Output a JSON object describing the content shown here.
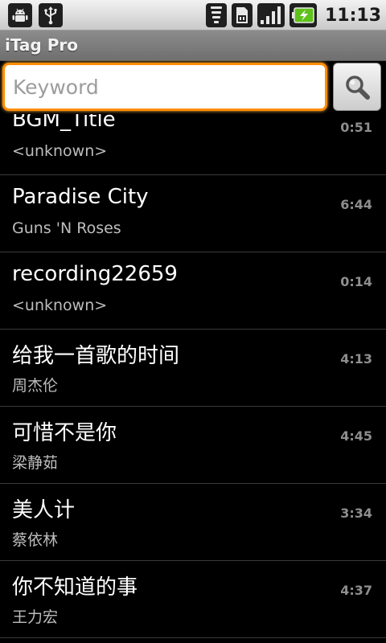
{
  "status_bar": {
    "left_icons": [
      "android-icon",
      "usb-icon"
    ],
    "right_icons": [
      "wifi-icon",
      "sim-card-icon",
      "signal-icon",
      "battery-charging-icon"
    ],
    "time": "11:13"
  },
  "app": {
    "title": "iTag Pro"
  },
  "search": {
    "placeholder": "Keyword",
    "value": "",
    "button_icon": "search-icon"
  },
  "songs": [
    {
      "title": "BGM_Title",
      "artist": "<unknown>",
      "duration": "0:51"
    },
    {
      "title": "Paradise City",
      "artist": "Guns 'N Roses",
      "duration": "6:44"
    },
    {
      "title": "recording22659",
      "artist": "<unknown>",
      "duration": "0:14"
    },
    {
      "title": "给我一首歌的时间",
      "artist": "周杰伦",
      "duration": "4:13"
    },
    {
      "title": "可惜不是你",
      "artist": "梁静茹",
      "duration": "4:45"
    },
    {
      "title": "美人计",
      "artist": "蔡依林",
      "duration": "3:34"
    },
    {
      "title": "你不知道的事",
      "artist": "王力宏",
      "duration": "4:37"
    }
  ],
  "colors": {
    "focus_accent": "#ff8d00",
    "battery_green": "#5fc21b"
  }
}
